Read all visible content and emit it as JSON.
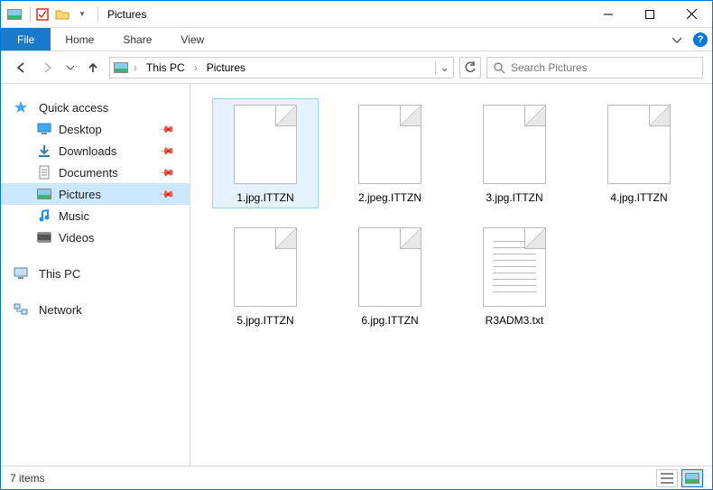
{
  "window": {
    "title": "Pictures"
  },
  "ribbon": {
    "file": "File",
    "tabs": [
      "Home",
      "Share",
      "View"
    ]
  },
  "breadcrumb": [
    "This PC",
    "Pictures"
  ],
  "search": {
    "placeholder": "Search Pictures"
  },
  "sidebar": {
    "quick_access": {
      "label": "Quick access",
      "items": [
        {
          "label": "Desktop",
          "pinned": true,
          "icon": "desktop"
        },
        {
          "label": "Downloads",
          "pinned": true,
          "icon": "downloads"
        },
        {
          "label": "Documents",
          "pinned": true,
          "icon": "documents"
        },
        {
          "label": "Pictures",
          "pinned": true,
          "icon": "pictures",
          "selected": true
        },
        {
          "label": "Music",
          "pinned": false,
          "icon": "music"
        },
        {
          "label": "Videos",
          "pinned": false,
          "icon": "videos"
        }
      ]
    },
    "this_pc": {
      "label": "This PC"
    },
    "network": {
      "label": "Network"
    }
  },
  "files": [
    {
      "name": "1.jpg.ITTZN",
      "type": "blank",
      "selected": true
    },
    {
      "name": "2.jpeg.ITTZN",
      "type": "blank"
    },
    {
      "name": "3.jpg.ITTZN",
      "type": "blank"
    },
    {
      "name": "4.jpg.ITTZN",
      "type": "blank"
    },
    {
      "name": "5.jpg.ITTZN",
      "type": "blank"
    },
    {
      "name": "6.jpg.ITTZN",
      "type": "blank"
    },
    {
      "name": "R3ADM3.txt",
      "type": "txt"
    }
  ],
  "status": {
    "count_label": "7 items"
  }
}
